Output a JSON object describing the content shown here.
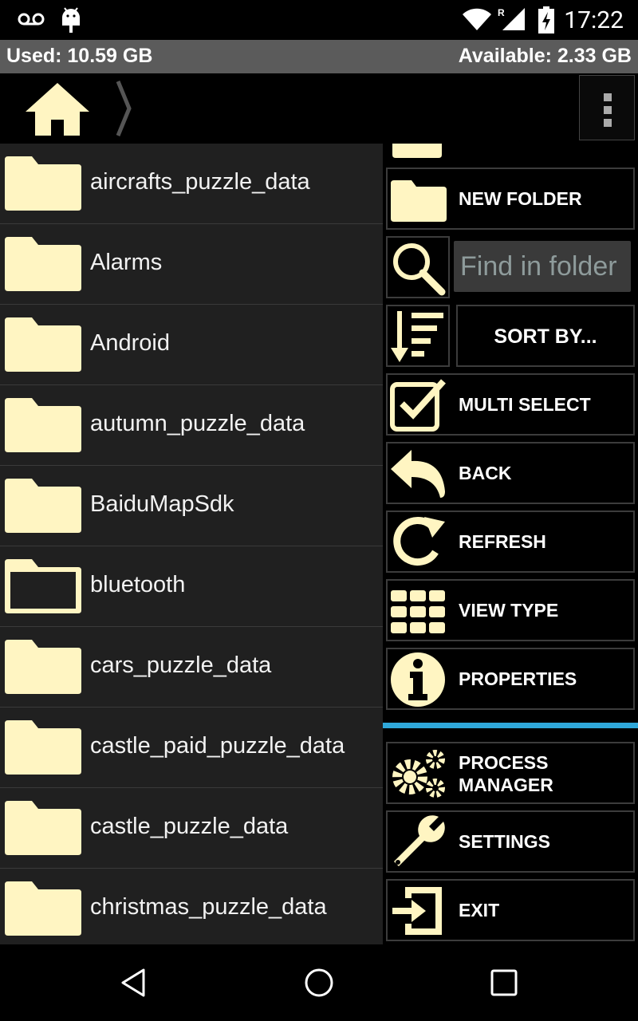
{
  "status_bar": {
    "time": "17:22"
  },
  "storage": {
    "used": "Used: 10.59 GB",
    "available": "Available: 2.33 GB"
  },
  "files": [
    {
      "name": "aircrafts_puzzle_data",
      "icon": "folder-icon"
    },
    {
      "name": "Alarms",
      "icon": "folder-icon"
    },
    {
      "name": "Android",
      "icon": "folder-icon"
    },
    {
      "name": "autumn_puzzle_data",
      "icon": "folder-icon"
    },
    {
      "name": "BaiduMapSdk",
      "icon": "folder-icon"
    },
    {
      "name": "bluetooth",
      "icon": "folder-outline-icon"
    },
    {
      "name": "cars_puzzle_data",
      "icon": "folder-icon"
    },
    {
      "name": "castle_paid_puzzle_data",
      "icon": "folder-icon"
    },
    {
      "name": "castle_puzzle_data",
      "icon": "folder-icon"
    },
    {
      "name": "christmas_puzzle_data",
      "icon": "folder-icon"
    }
  ],
  "menu": {
    "new_folder": "NEW FOLDER",
    "find_placeholder": "Find in folder",
    "sort_by": "SORT BY...",
    "multi_select": "MULTI SELECT",
    "back": "BACK",
    "refresh": "REFRESH",
    "view_type": "VIEW TYPE",
    "properties": "PROPERTIES",
    "process_manager_line1": "PROCESS",
    "process_manager_line2": "MANAGER",
    "settings": "SETTINGS",
    "exit": "EXIT"
  },
  "colors": {
    "accent": "#FFF5C2",
    "divider": "#2FA8DA",
    "list_bg": "#202020"
  }
}
